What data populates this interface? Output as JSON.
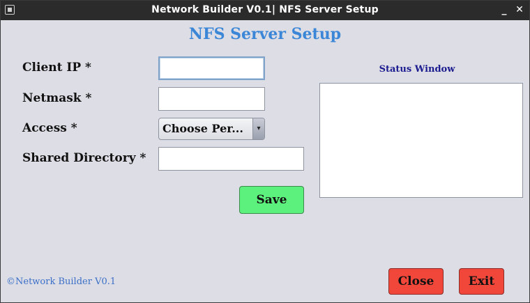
{
  "window": {
    "title": "Network Builder V0.1| NFS Server Setup",
    "minimize_glyph": "_",
    "close_glyph": "✕",
    "icon": "app-icon"
  },
  "heading": "NFS Server Setup",
  "form": {
    "client_ip": {
      "label": "Client IP *",
      "value": ""
    },
    "netmask": {
      "label": "Netmask *",
      "value": ""
    },
    "access": {
      "label": "Access *",
      "selected": "Choose Per...",
      "arrow_glyph": "▾"
    },
    "shared_directory": {
      "label": "Shared Directory *",
      "value": ""
    }
  },
  "buttons": {
    "save": "Save",
    "close": "Close",
    "exit": "Exit"
  },
  "status": {
    "label": "Status Window",
    "content": ""
  },
  "footer": "©Network Builder V0.1",
  "colors": {
    "heading": "#3b86d6",
    "save_button": "#5cf07c",
    "danger_button": "#f0473a",
    "status_label": "#1b1b8f",
    "footer_text": "#3b6fc7",
    "window_bg": "#dcdde5",
    "titlebar_bg": "#2b2b2b"
  }
}
